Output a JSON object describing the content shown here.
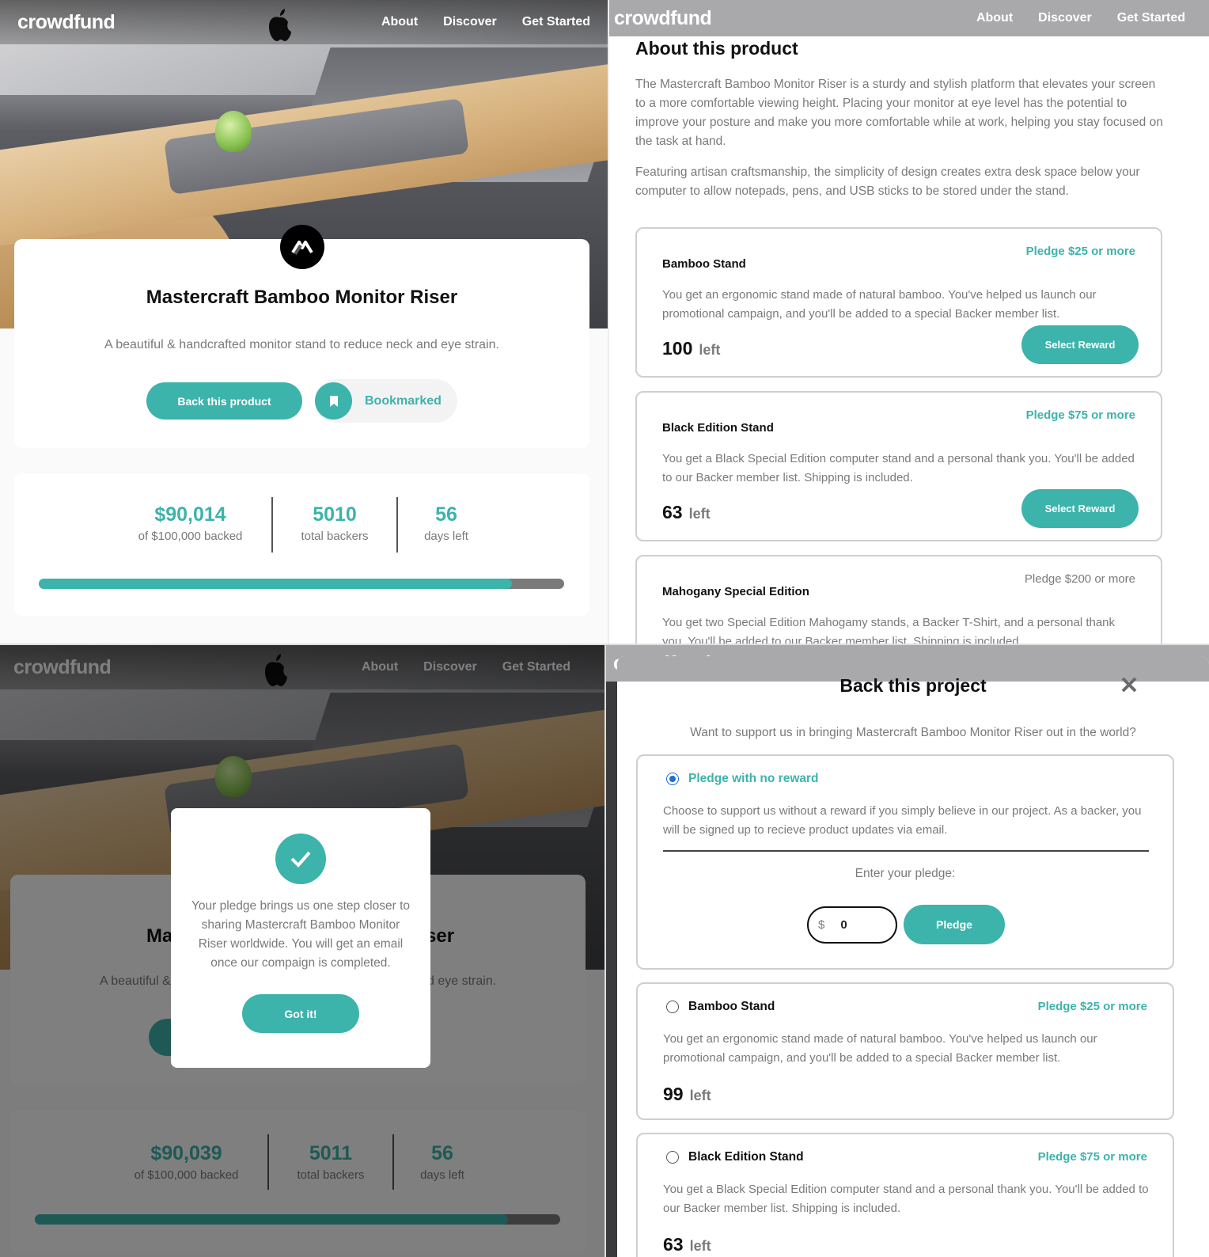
{
  "brand": "crowdfund",
  "nav": {
    "about": "About",
    "discover": "Discover",
    "get_started": "Get Started"
  },
  "colors": {
    "accent": "#3cb3ab",
    "dark_accent": "#147a74",
    "grey_text": "#7a7a7a",
    "radio_selected": "#1b6fd6"
  },
  "icons": {
    "logo_mark": "mastercraft-logo-icon",
    "bookmark": "bookmark-icon",
    "check": "check-icon",
    "close": "close-icon",
    "apple": "apple-logo-icon"
  },
  "product": {
    "title": "Mastercraft Bamboo Monitor Riser",
    "subtitle": "A beautiful & handcrafted monitor stand to reduce neck and eye strain.",
    "back_button": "Back this product",
    "bookmark_label": "Bookmarked"
  },
  "stats": {
    "backed": "$90,014",
    "backed_label": "of $100,000 backed",
    "backers": "5010",
    "backers_label": "total backers",
    "days": "56",
    "days_label": "days left",
    "progress_fraction": 0.9
  },
  "about": {
    "heading": "About this product",
    "p1": "The Mastercraft Bamboo Monitor Riser is a sturdy and stylish platform that elevates your screen to a more comfortable viewing height. Placing your monitor at eye level has the potential to improve your posture and make you more comfortable while at work, helping you stay focused on the task at hand.",
    "p2": "Featuring artisan craftsmanship, the simplicity of design creates extra desk space below your computer to allow notepads, pens, and USB sticks to be stored under the stand."
  },
  "rewards": [
    {
      "name": "Bamboo Stand",
      "pledge": "Pledge $25 or more",
      "desc": "You get an ergonomic stand made of natural bamboo. You've helped us launch our promotional campaign, and you'll be added to a special Backer member list.",
      "left": "100",
      "left_label": "left",
      "button": "Select Reward"
    },
    {
      "name": "Black Edition Stand",
      "pledge": "Pledge $75 or more",
      "desc": "You get a Black Special Edition computer stand and a personal thank you. You'll be added to our Backer member list. Shipping is included.",
      "left": "63",
      "left_label": "left",
      "button": "Select Reward"
    },
    {
      "name": "Mahogany Special Edition",
      "pledge": "Pledge $200 or more",
      "desc": "You get two Special Edition Mahogamy stands, a Backer T-Shirt, and a personal thank you. You'll be added to our Backer member list. Shipping is included."
    }
  ],
  "success": {
    "message": "Your pledge brings us one step closer to sharing Mastercraft Bamboo Monitor Riser worldwide. You will get an email once our compaign is completed.",
    "button": "Got it!",
    "title_left": "Ma",
    "title_right": "ser",
    "sub_left": "A beautiful &",
    "sub_right": "d eye strain.",
    "backed": "$90,039",
    "backed_label": "of $100,000 backed",
    "backers": "5011",
    "backers_label": "total backers",
    "days": "56",
    "days_label": "days left",
    "progress_fraction": 0.9
  },
  "modal": {
    "title": "Back this project",
    "subtitle": "Want to support us in bringing Mastercraft Bamboo Monitor Riser out in the world?",
    "no_reward": {
      "name": "Pledge with no reward",
      "desc": "Choose to support us without a reward if you simply believe in our project. As a backer, you will be signed up to recieve product updates via email.",
      "enter_label": "Enter your pledge:",
      "currency": "$",
      "value": "0",
      "button": "Pledge"
    },
    "options": [
      {
        "name": "Bamboo Stand",
        "pledge": "Pledge $25 or more",
        "desc": "You get an ergonomic stand made of natural bamboo. You've helped us launch our promotional campaign, and you'll be added to a special Backer member list.",
        "left": "99",
        "left_label": "left"
      },
      {
        "name": "Black Edition Stand",
        "pledge": "Pledge $75 or more",
        "desc": "You get a Black Special Edition computer stand and a personal thank you. You'll be added to our Backer member list. Shipping is included.",
        "left": "63",
        "left_label": "left"
      }
    ]
  }
}
